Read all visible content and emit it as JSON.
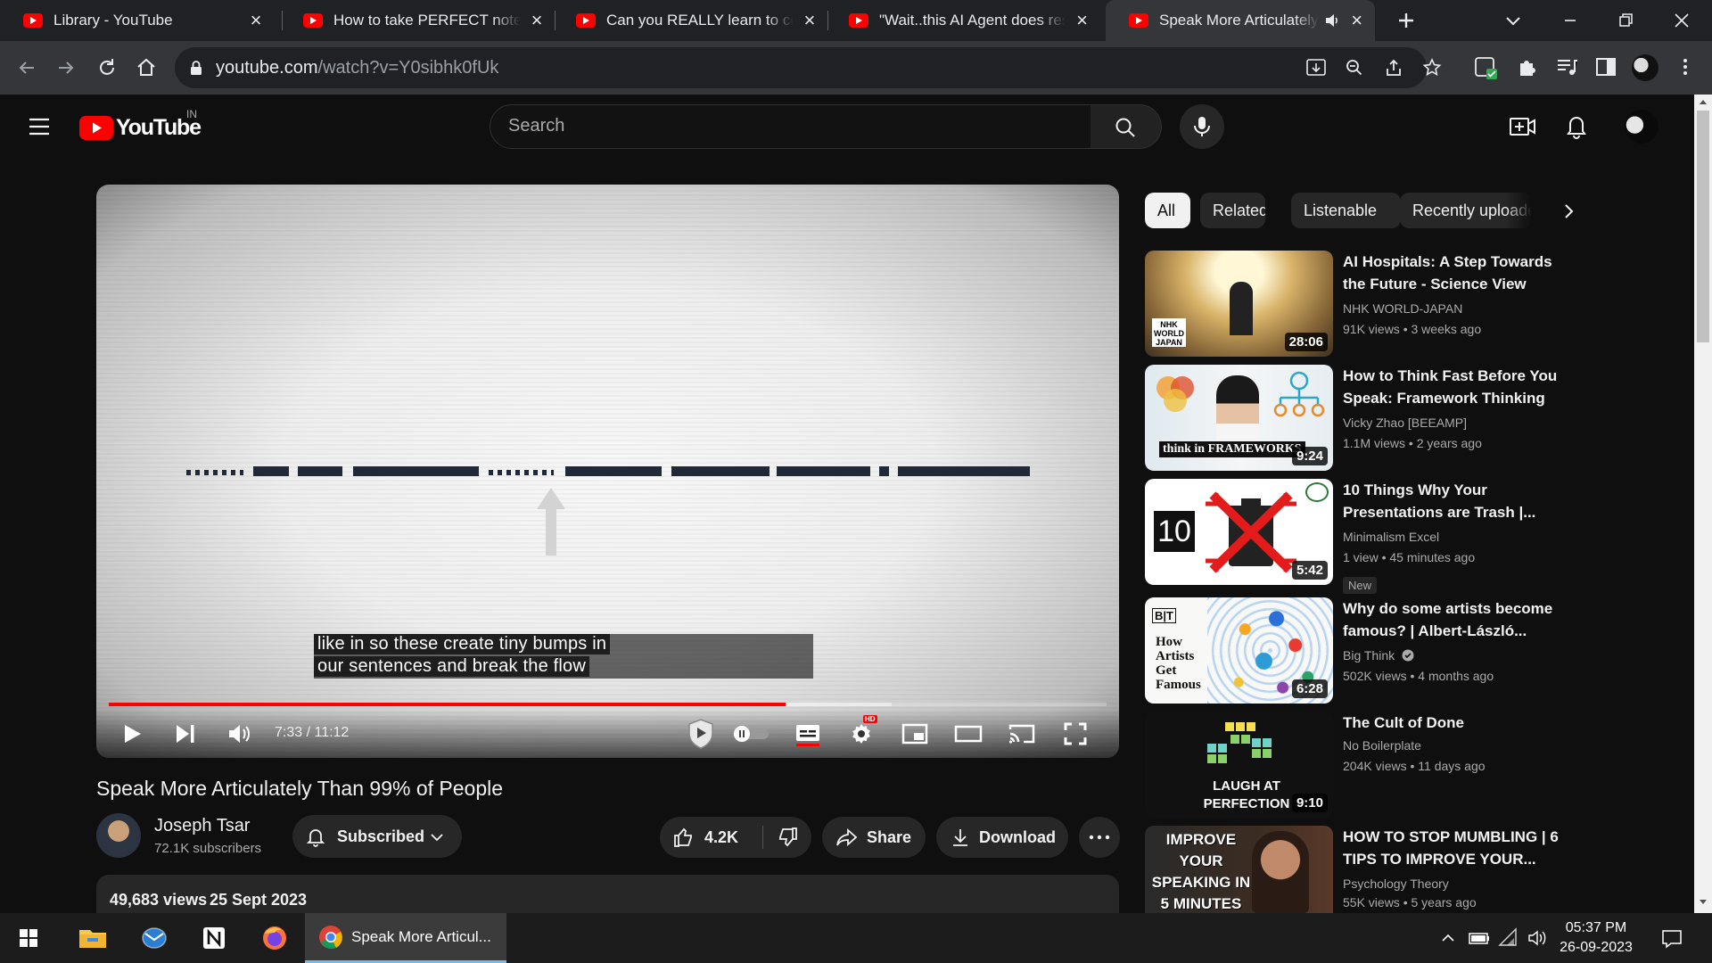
{
  "browser": {
    "tabs": [
      {
        "title": "Library - YouTube"
      },
      {
        "title": "How to take PERFECT notes w"
      },
      {
        "title": "Can you REALLY learn to code"
      },
      {
        "title": "\"Wait..this AI Agent does rese"
      },
      {
        "title": "Speak More Articulately T"
      }
    ],
    "url_host": "youtube.com",
    "url_path": "/watch?v=Y0sibhk0fUk"
  },
  "yt": {
    "logo_text": "YouTube",
    "region": "IN",
    "search_placeholder": "Search"
  },
  "player": {
    "caption_line1": "like in so these create tiny bumps in",
    "caption_line2": "our sentences and break the flow",
    "time": "7:33 / 11:12",
    "progress_fraction": 0.678,
    "buffered_fraction": 0.785,
    "hd_badge": "HD"
  },
  "video": {
    "title": "Speak More Articulately Than 99% of People",
    "channel": "Joseph Tsar",
    "subscribers": "72.1K subscribers",
    "subscribe_label": "Subscribed",
    "likes": "4.2K",
    "share_label": "Share",
    "download_label": "Download",
    "views": "49,683 views",
    "date": "25 Sept 2023"
  },
  "chips": [
    "All",
    "Related",
    "Listenable",
    "Recently uploaded"
  ],
  "recs": [
    {
      "title": "AI Hospitals: A Step Towards the Future - Science View",
      "channel": "NHK WORLD-JAPAN",
      "views": "91K views",
      "age": "3 weeks ago",
      "duration": "28:06",
      "thumb_text": "NHK WORLD JAPAN"
    },
    {
      "title": "How to Think Fast Before You Speak: Framework Thinking",
      "channel": "Vicky Zhao [BEEAMP]",
      "views": "1.1M views",
      "age": "2 years ago",
      "duration": "9:24",
      "thumb_text": "think in FRAMEWORKS"
    },
    {
      "title": "10 Things Why Your Presentations are Trash |...",
      "channel": "Minimalism Excel",
      "views": "1 view",
      "age": "45 minutes ago",
      "duration": "5:42",
      "badge": "New",
      "thumb_text": "10"
    },
    {
      "title": "Why do some artists become famous? | Albert-László...",
      "channel": "Big Think",
      "views": "502K views",
      "age": "4 months ago",
      "duration": "6:28",
      "thumb_text": "How Artists Get Famous",
      "thumb_logo": "B|T"
    },
    {
      "title": "The Cult of Done",
      "channel": "No Boilerplate",
      "views": "204K views",
      "age": "11 days ago",
      "duration": "9:10",
      "thumb_text": "LAUGH AT PERFECTION"
    },
    {
      "title": "HOW TO STOP MUMBLING | 6 TIPS TO IMPROVE YOUR...",
      "channel": "Psychology Theory",
      "views": "55K views",
      "age": "5 years ago",
      "duration": "",
      "thumb_text": "IMPROVE YOUR SPEAKING IN 5 MINUTES"
    }
  ],
  "taskbar": {
    "active_app": "Speak More Articul...",
    "time": "05:37 PM",
    "date": "26-09-2023"
  },
  "colors": {
    "accent": "#ff0000",
    "bg": "#0f0f0f",
    "chip": "#272727"
  }
}
